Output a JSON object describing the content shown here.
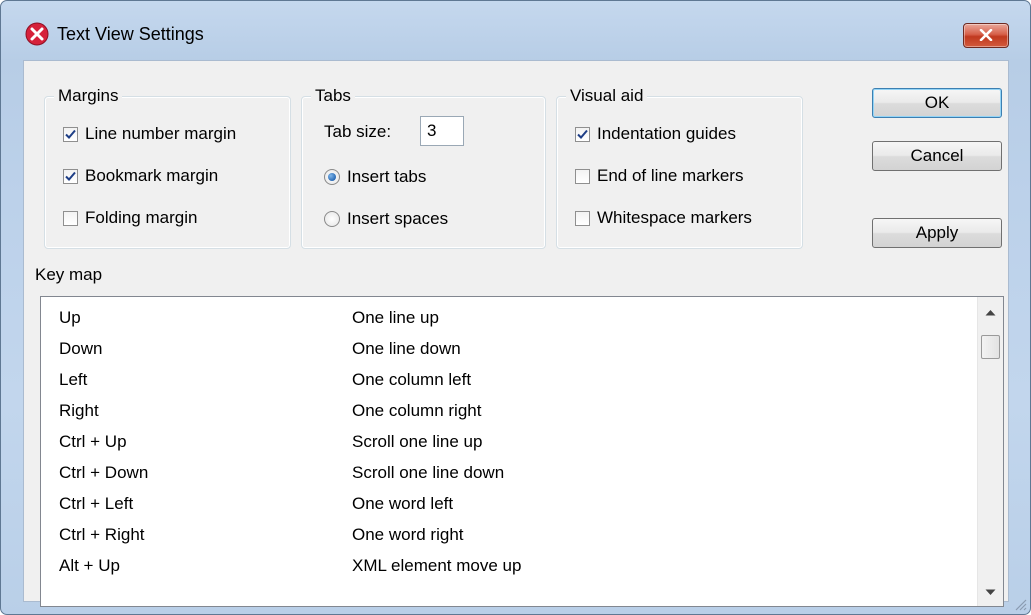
{
  "window": {
    "title": "Text View Settings"
  },
  "margins": {
    "label": "Margins",
    "items": [
      {
        "label": "Line number margin",
        "checked": true
      },
      {
        "label": "Bookmark margin",
        "checked": true
      },
      {
        "label": "Folding margin",
        "checked": false
      }
    ]
  },
  "tabs": {
    "label": "Tabs",
    "size_label": "Tab size:",
    "size_value": "3",
    "options": [
      {
        "label": "Insert tabs",
        "selected": true
      },
      {
        "label": "Insert spaces",
        "selected": false
      }
    ]
  },
  "visual_aid": {
    "label": "Visual aid",
    "items": [
      {
        "label": "Indentation guides",
        "checked": true
      },
      {
        "label": "End of line markers",
        "checked": false
      },
      {
        "label": "Whitespace markers",
        "checked": false
      }
    ]
  },
  "buttons": {
    "ok": "OK",
    "cancel": "Cancel",
    "apply": "Apply"
  },
  "keymap": {
    "label": "Key map",
    "rows": [
      {
        "key": "Up",
        "action": "One line up"
      },
      {
        "key": "Down",
        "action": "One line down"
      },
      {
        "key": "Left",
        "action": "One column left"
      },
      {
        "key": "Right",
        "action": "One column right"
      },
      {
        "key": "Ctrl + Up",
        "action": "Scroll one line up"
      },
      {
        "key": "Ctrl + Down",
        "action": "Scroll one line down"
      },
      {
        "key": "Ctrl + Left",
        "action": "One word left"
      },
      {
        "key": "Ctrl + Right",
        "action": "One word right"
      },
      {
        "key": "Alt + Up",
        "action": "XML element move up"
      }
    ]
  },
  "colors": {
    "title_bar": "#c5d8ee",
    "close_button": "#c0391f",
    "dialog_face": "#f0f0f0",
    "radio_selected": "#1d5fad"
  }
}
